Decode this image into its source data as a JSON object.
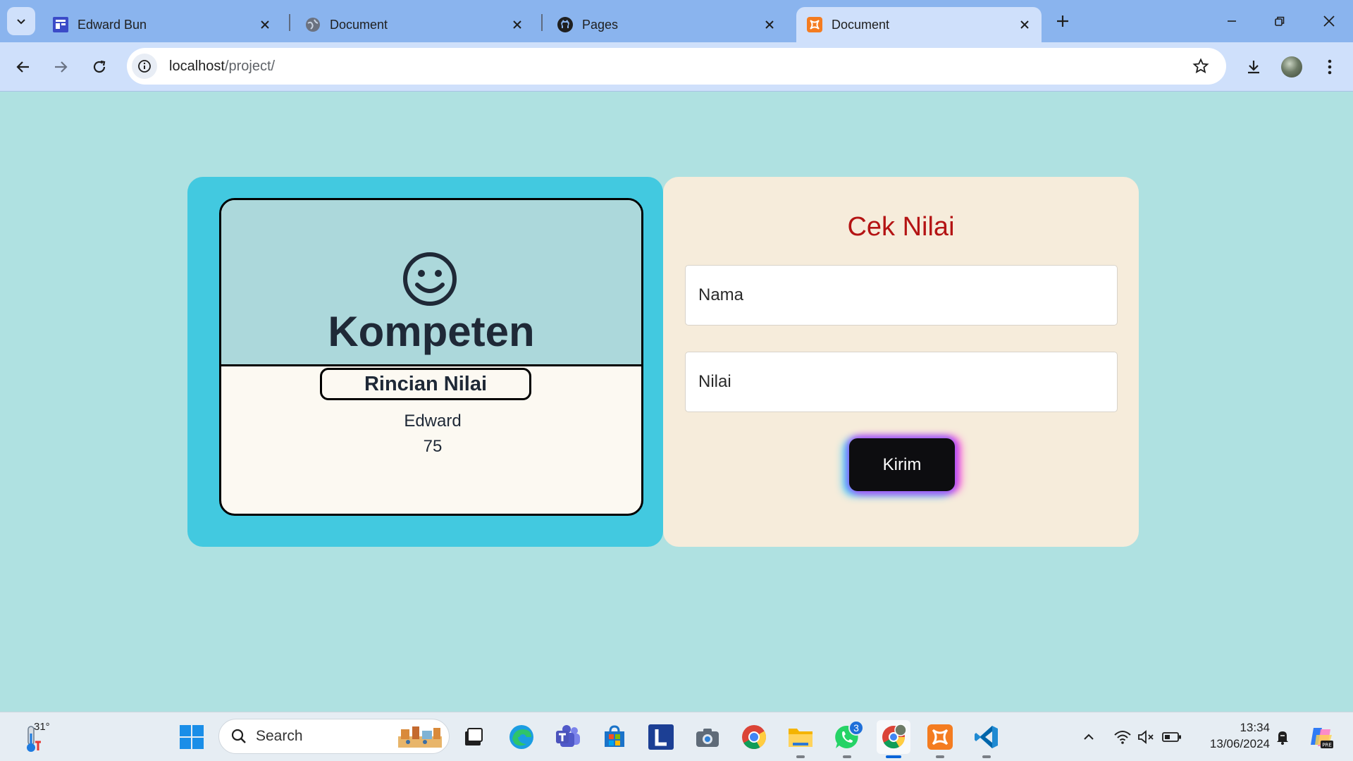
{
  "browser": {
    "tabs": [
      {
        "title": "Edward Bun",
        "icon": "edward-bun-favicon",
        "active": false
      },
      {
        "title": "Document",
        "icon": "globe-favicon",
        "active": false
      },
      {
        "title": "Pages",
        "icon": "github-favicon",
        "active": false
      },
      {
        "title": "Document",
        "icon": "xampp-favicon",
        "active": true
      }
    ],
    "url_host": "localhost",
    "url_path": "/project/"
  },
  "result_card": {
    "emoji": "☺",
    "status": "Kompeten",
    "detail_title": "Rincian Nilai",
    "name": "Edward",
    "score": "75"
  },
  "form": {
    "title": "Cek Nilai",
    "name_placeholder": "Nama",
    "score_placeholder": "Nilai",
    "submit_label": "Kirim"
  },
  "taskbar": {
    "weather_temp": "31°",
    "search_label": "Search",
    "whatsapp_badge": "3",
    "time": "13:34",
    "date": "13/06/2024"
  },
  "colors": {
    "page_bg": "#afe1e1",
    "left_card": "#42c9e0",
    "right_card": "#f6ecdb",
    "title_red": "#b41414",
    "tabstrip": "#8ab4ee",
    "toolbar": "#cfe0fb"
  }
}
